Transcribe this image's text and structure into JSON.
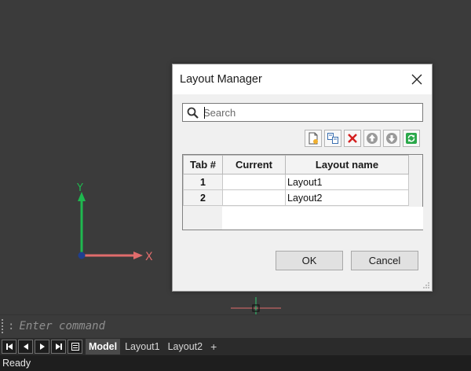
{
  "dialog": {
    "title": "Layout Manager",
    "search": {
      "placeholder": "Search",
      "value": ""
    },
    "toolbar": [
      {
        "name": "new-layout",
        "icon": "new-document-icon"
      },
      {
        "name": "copy-layout",
        "icon": "copy-layout-icon"
      },
      {
        "name": "delete-layout",
        "icon": "delete-x-icon"
      },
      {
        "name": "move-up",
        "icon": "arrow-up-circle-icon"
      },
      {
        "name": "move-down",
        "icon": "arrow-down-circle-icon"
      },
      {
        "name": "refresh",
        "icon": "refresh-icon"
      }
    ],
    "table": {
      "headers": [
        "Tab #",
        "Current",
        "Layout name"
      ],
      "rows": [
        {
          "tab": "1",
          "current": "",
          "name": "Layout1"
        },
        {
          "tab": "2",
          "current": "",
          "name": "Layout2"
        }
      ]
    },
    "ok_label": "OK",
    "cancel_label": "Cancel"
  },
  "canvas": {
    "ucs": {
      "y_label": "Y",
      "x_label": "X"
    }
  },
  "command_line": {
    "prompt": ":",
    "placeholder": "Enter command"
  },
  "layout_tabs": {
    "tabs": [
      {
        "label": "Model",
        "active": true
      },
      {
        "label": "Layout1",
        "active": false
      },
      {
        "label": "Layout2",
        "active": false
      }
    ],
    "add_label": "+"
  },
  "status": {
    "text": "Ready"
  },
  "colors": {
    "canvas_bg": "#3b3b3b",
    "x_axis": "#e06c6c",
    "y_axis": "#1fb84f",
    "origin": "#1f3f8f",
    "crosshair_h": "#e06c6c",
    "crosshair_v": "#2ecc71"
  }
}
